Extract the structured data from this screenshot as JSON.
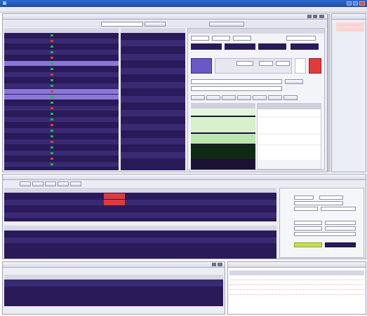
{
  "app": {
    "title": "",
    "menu": []
  },
  "colors": {
    "titlebar": "#1d4fa8",
    "dark_grid": "#2a1a5a",
    "row_alt": "#3a2a74",
    "row_highlight": "#8a78d8",
    "red": "#e23a3a",
    "green": "#19b84a",
    "pale_green": "#d9f2cc",
    "order_pink": "#ffd2d2"
  },
  "icons": [
    "minimize-icon",
    "maximize-icon",
    "close-icon",
    "lock-icon",
    "link-icon",
    "pin-icon",
    "scroll-down-icon"
  ],
  "watchlist_rows": 24,
  "depth_rows": 18,
  "order_rows": 4,
  "position_rows": 2,
  "log_rows": 4
}
